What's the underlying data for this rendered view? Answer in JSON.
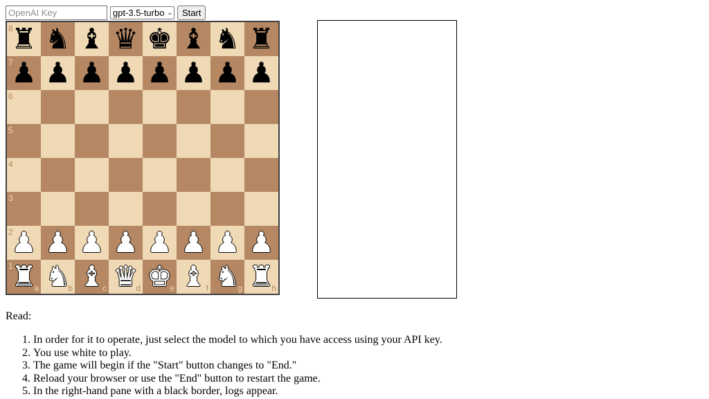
{
  "controls": {
    "key_placeholder": "OpenAI Key",
    "model_selected": "gpt-3.5-turbo",
    "start_label": "Start"
  },
  "board": {
    "colors": {
      "light": "#f0d9b5",
      "dark": "#b58863"
    },
    "ranks": [
      "8",
      "7",
      "6",
      "5",
      "4",
      "3",
      "2",
      "1"
    ],
    "files": [
      "a",
      "b",
      "c",
      "d",
      "e",
      "f",
      "g",
      "h"
    ],
    "position": [
      [
        "black-rook",
        "black-knight",
        "black-bishop",
        "black-queen",
        "black-king",
        "black-bishop",
        "black-knight",
        "black-rook"
      ],
      [
        "black-pawn",
        "black-pawn",
        "black-pawn",
        "black-pawn",
        "black-pawn",
        "black-pawn",
        "black-pawn",
        "black-pawn"
      ],
      [
        "",
        "",
        "",
        "",
        "",
        "",
        "",
        ""
      ],
      [
        "",
        "",
        "",
        "",
        "",
        "",
        "",
        ""
      ],
      [
        "",
        "",
        "",
        "",
        "",
        "",
        "",
        ""
      ],
      [
        "",
        "",
        "",
        "",
        "",
        "",
        "",
        ""
      ],
      [
        "white-pawn",
        "white-pawn",
        "white-pawn",
        "white-pawn",
        "white-pawn",
        "white-pawn",
        "white-pawn",
        "white-pawn"
      ],
      [
        "white-rook",
        "white-knight",
        "white-bishop",
        "white-queen",
        "white-king",
        "white-bishop",
        "white-knight",
        "white-rook"
      ]
    ]
  },
  "instructions": {
    "heading": "Read:",
    "steps": [
      "In order for it to operate, just select the model to which you have access using your API key.",
      "You use white to play.",
      "The game will begin if the \"Start\" button changes to \"End.\"",
      "Reload your browser or use the \"End\" button to restart the game.",
      "In the right-hand pane with a black border, logs appear."
    ]
  }
}
